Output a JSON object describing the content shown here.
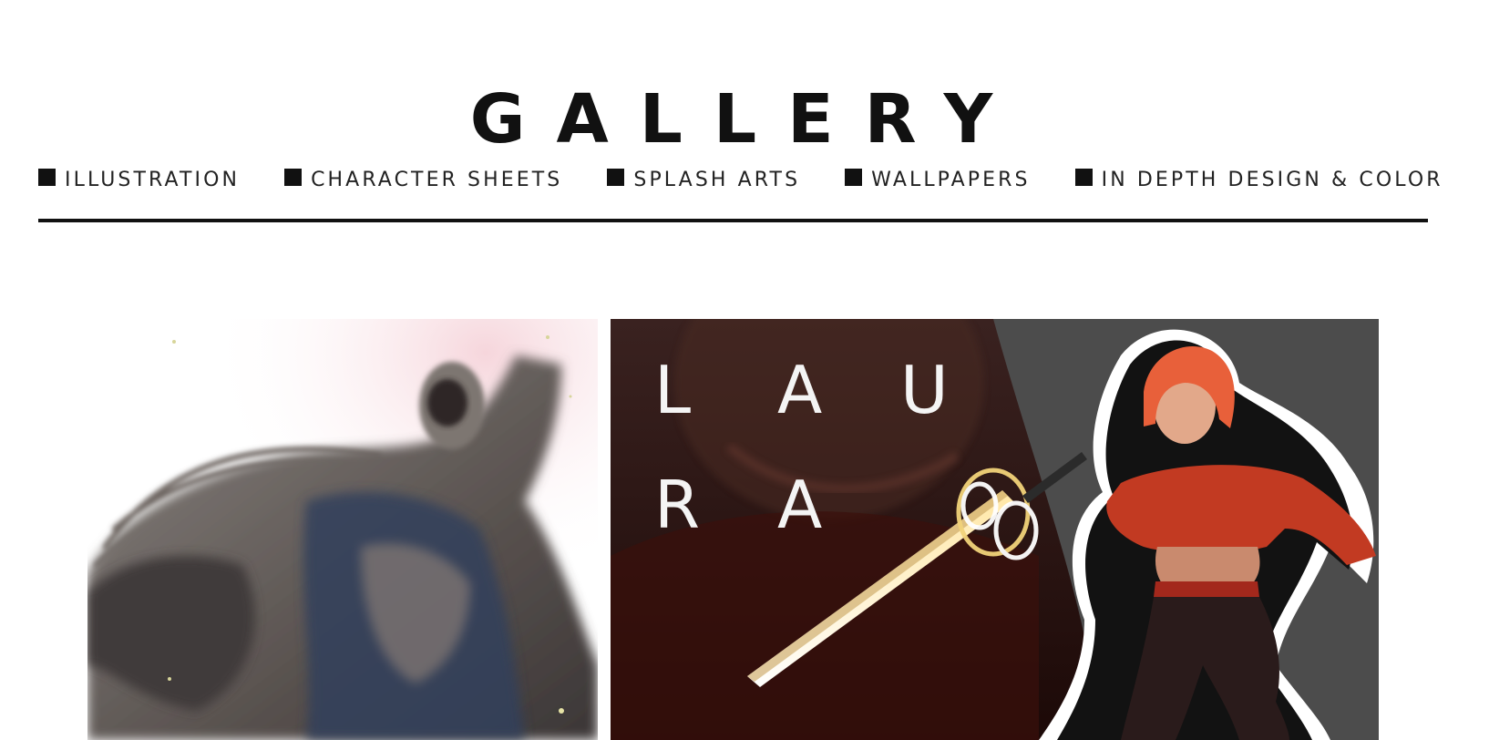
{
  "header": {
    "title": "GALLERY"
  },
  "nav": {
    "items": [
      {
        "label": "ILLUSTRATION"
      },
      {
        "label": "CHARACTER SHEETS"
      },
      {
        "label": "SPLASH ARTS"
      },
      {
        "label": "WALLPAPERS"
      },
      {
        "label": "IN DEPTH DESIGN & COLOR"
      }
    ]
  },
  "gallery": {
    "items": [
      {
        "icon": "knight-artwork"
      },
      {
        "icon": "character-splash-artwork",
        "title_letters": [
          "L",
          "A",
          "U",
          "R",
          "A"
        ]
      }
    ]
  },
  "colors": {
    "text": "#111111",
    "background": "#ffffff",
    "accent_red": "#c0351f",
    "dark_bg": "#2a1312"
  }
}
